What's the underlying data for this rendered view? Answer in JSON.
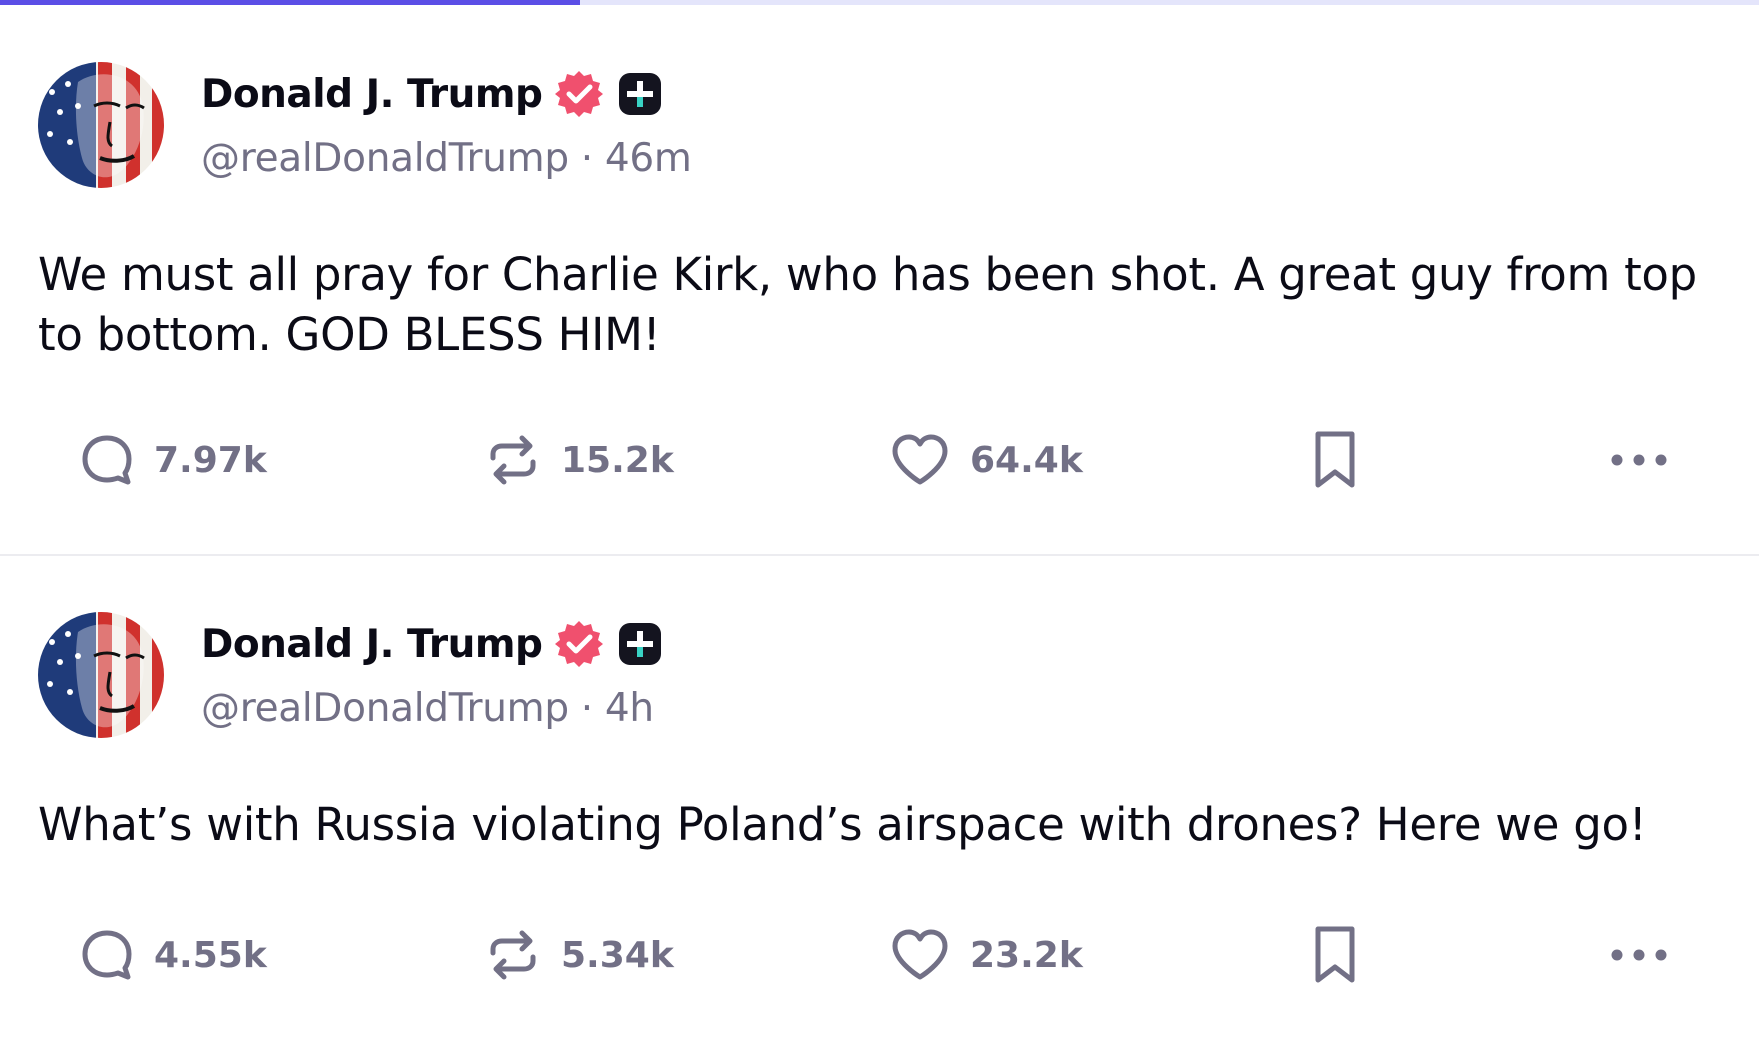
{
  "progress": {
    "fraction": 0.33,
    "fill_color": "#5b4ee6",
    "track_color": "#e4e5fb"
  },
  "colors": {
    "verified_badge": "#f0506e",
    "plus_badge": "#14141f",
    "plus_accent": "#39d3c5",
    "muted_text": "#727086"
  },
  "posts": [
    {
      "author": {
        "display_name": "Donald J. Trump",
        "handle": "@realDonaldTrump",
        "avatar_icon": "flag-portrait-avatar"
      },
      "time": "46m",
      "separator": "·",
      "text": "We must all pray for Charlie Kirk, who has been shot. A great guy from top to bottom. GOD BLESS HIM!",
      "stats": {
        "replies": "7.97k",
        "restores": "15.2k",
        "likes": "64.4k"
      }
    },
    {
      "author": {
        "display_name": "Donald J. Trump",
        "handle": "@realDonaldTrump",
        "avatar_icon": "flag-portrait-avatar"
      },
      "time": "4h",
      "separator": "·",
      "text": "What’s with Russia violating Poland’s airspace with drones? Here we go!",
      "stats": {
        "replies": "4.55k",
        "restores": "5.34k",
        "likes": "23.2k"
      }
    }
  ]
}
